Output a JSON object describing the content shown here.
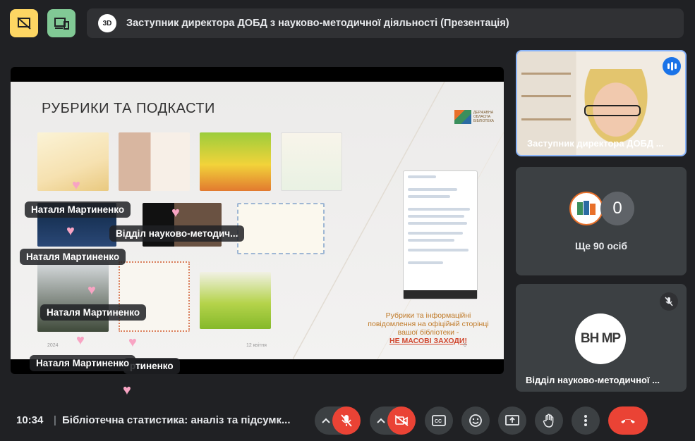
{
  "window": {
    "title": "Заступник директора ДОБД з науково-методичної діяльності (Презентація)",
    "logo_text": "3D"
  },
  "slide": {
    "title": "РУБРИКИ ТА ПОДКАСТИ",
    "caption_line1": "Рубрики та інформаційні повідомлення на офіційній сторінці вашої бібліотеки -",
    "caption_emph": "НЕ МАСОВІ ЗАХОДИ",
    "caption_end": "!",
    "slide_number": "6",
    "year": "2024",
    "date": "12 квітня"
  },
  "overlays": [
    {
      "label": "Наталя Мартиненко"
    },
    {
      "label": "Відділ науково-методич..."
    },
    {
      "label": "Наталя Мартиненко"
    },
    {
      "label": "Наталя Мартиненко"
    },
    {
      "label": "Наталя Мартиненко"
    },
    {
      "label": "ртиненко"
    }
  ],
  "tiles": {
    "presenter_label": "Заступник директора ДОБД ...",
    "others_count_badge": "0",
    "others_text": "Ще 90 осіб",
    "dept_label": "Відділ науково-методичної ...",
    "dept_logo_text": "ВН МР"
  },
  "bottom_bar": {
    "time": "10:34",
    "separator": "|",
    "meeting_name": "Бібліотечна статистика: аналіз та підсумк..."
  },
  "colors": {
    "background": "#202124",
    "end_call": "#ea4335",
    "accent_blue": "#8ab4f8",
    "caption_orange": "#c07a28"
  }
}
